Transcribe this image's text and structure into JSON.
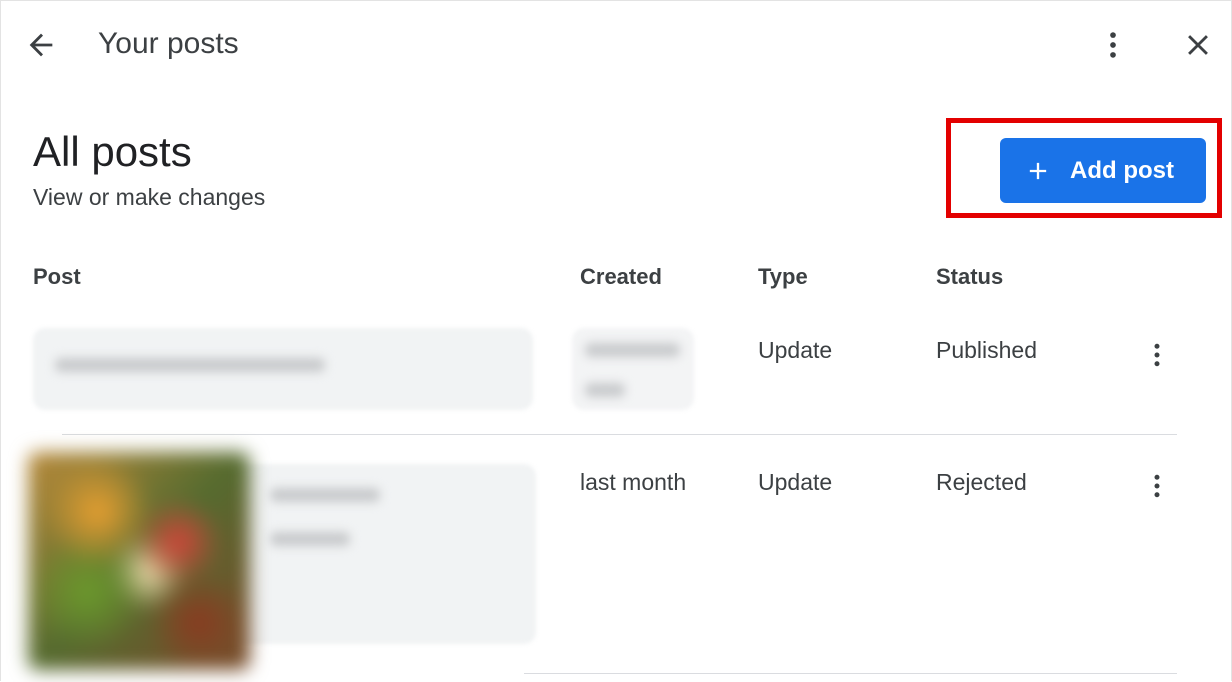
{
  "toolbar": {
    "title": "Your posts"
  },
  "header": {
    "title": "All posts",
    "subtitle": "View or make changes",
    "add_button_label": "Add post"
  },
  "table": {
    "columns": [
      "Post",
      "Created",
      "Type",
      "Status"
    ],
    "rows": [
      {
        "created": "",
        "type": "Update",
        "status": "Published"
      },
      {
        "created": "last month",
        "type": "Update",
        "status": "Rejected"
      }
    ]
  },
  "icons": {
    "back": "arrow-back-icon",
    "more": "more-vert-icon",
    "close": "close-icon",
    "add": "plus-icon"
  },
  "colors": {
    "accent": "#1a73e8",
    "highlight": "#e30000"
  }
}
